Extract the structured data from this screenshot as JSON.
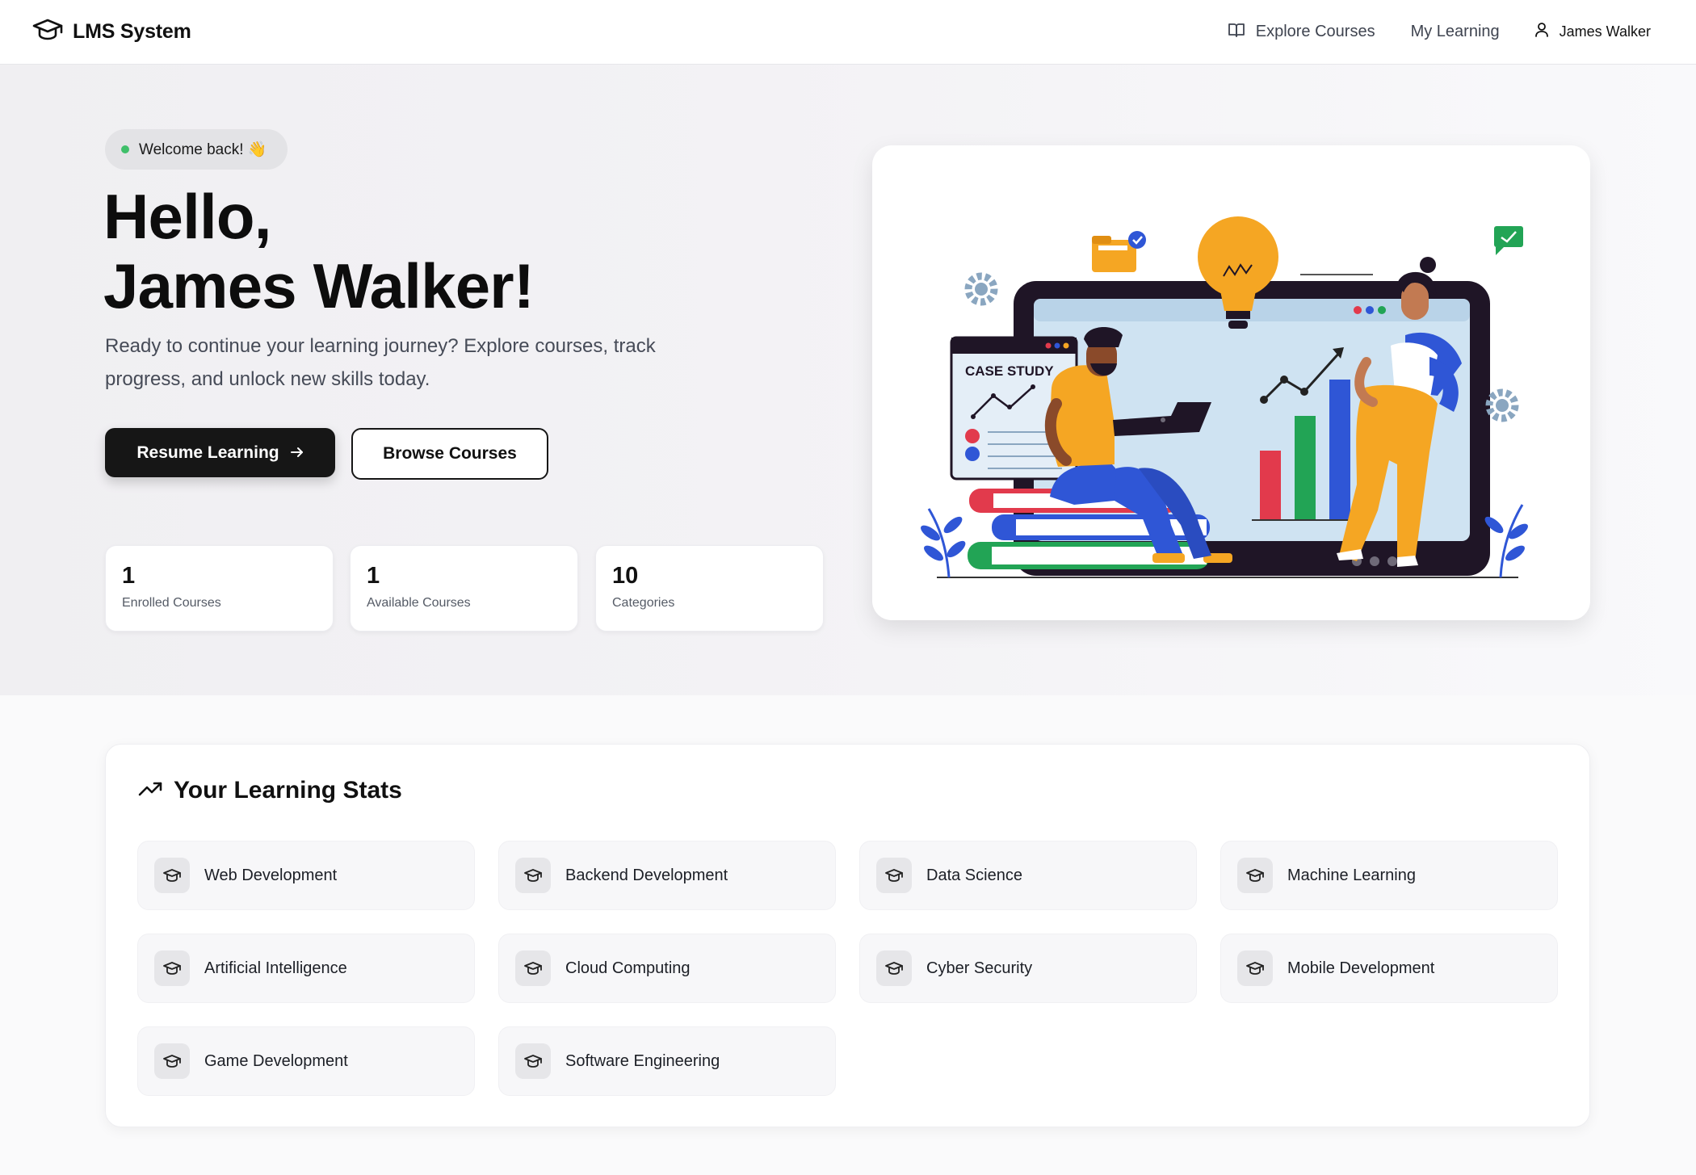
{
  "nav": {
    "brand": "LMS System",
    "links": [
      {
        "label": "Explore Courses",
        "icon": "book-open-icon"
      },
      {
        "label": "My Learning"
      },
      {
        "label": "James Walker",
        "icon": "user-icon"
      }
    ]
  },
  "hero": {
    "badge": "Welcome back! 👋",
    "title_line1": "Hello,",
    "title_line2": "James Walker!",
    "description": "Ready to continue your learning journey? Explore courses, track progress, and unlock new skills today.",
    "primary_button": "Resume Learning",
    "secondary_button": "Browse Courses",
    "stats": [
      {
        "value": "1",
        "label": "Enrolled Courses"
      },
      {
        "value": "1",
        "label": "Available Courses"
      },
      {
        "value": "10",
        "label": "Categories"
      }
    ],
    "illustration_text": "CASE STUDY"
  },
  "learning_stats": {
    "title": "Your Learning Stats",
    "categories": [
      "Web Development",
      "Backend Development",
      "Data Science",
      "Machine Learning",
      "Artificial Intelligence",
      "Cloud Computing",
      "Cyber Security",
      "Mobile Development",
      "Game Development",
      "Software Engineering"
    ]
  },
  "colors": {
    "primary": "#161616",
    "online_dot": "#3fbf6a",
    "hero_bg": "#f1f0f3"
  }
}
